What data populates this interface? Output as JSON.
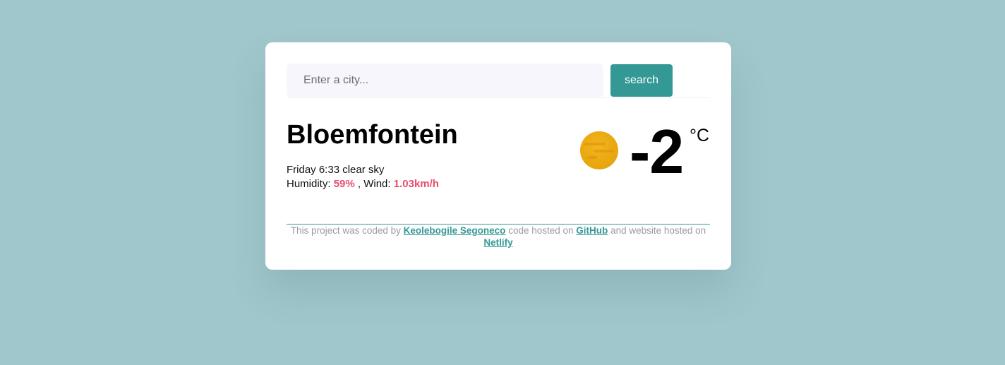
{
  "search": {
    "placeholder": "Enter a city...",
    "button_label": "search"
  },
  "weather": {
    "city": "Bloemfontein",
    "day_time": "Friday 6:33",
    "description": "clear sky",
    "humidity_label": "Humidity:",
    "humidity_value": "59%",
    "wind_label": ", Wind:",
    "wind_value": "1.03km/h",
    "icon": "sun-icon",
    "temperature": "-2",
    "unit": "°C"
  },
  "footer": {
    "text_1": "This project was coded by",
    "author_link": "Keolebogile Segoneco",
    "text_2": "code hosted on",
    "github_link": "GitHub",
    "text_3": "and website hosted on",
    "netlify_link": "Netlify"
  },
  "colors": {
    "background": "#a0c7cb",
    "accent": "#349895",
    "highlight": "#e84d6d",
    "card": "#ffffff"
  }
}
